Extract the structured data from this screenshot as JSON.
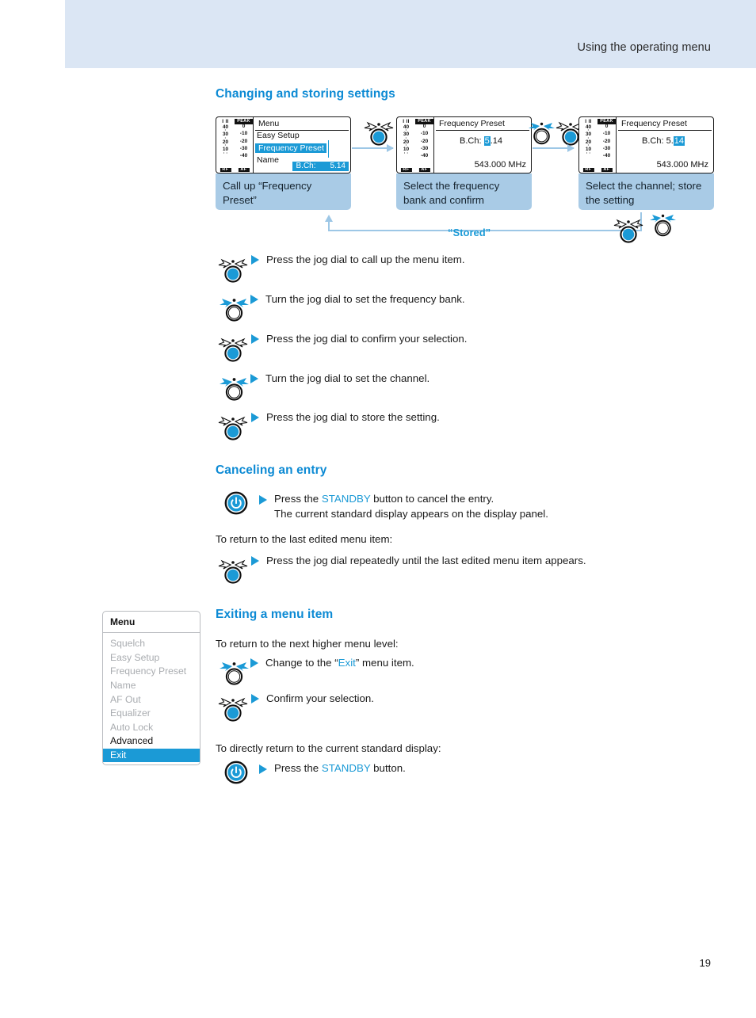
{
  "header": {
    "title": "Using the operating menu"
  },
  "page": {
    "number": "19"
  },
  "colors": {
    "accent_blue": "#1b9ad6",
    "header_band": "#dbe6f4",
    "caption_box": "#a9cbe6",
    "flow_arrow": "#9dc7e6"
  },
  "sections": {
    "changing": {
      "heading": "Changing and storing settings",
      "flow": {
        "panels": [
          {
            "display": {
              "title": "Menu",
              "lines": [
                "Easy Setup",
                "Frequency Preset",
                "Name"
              ],
              "selected_line": "Frequency Preset",
              "bch_label": "B.Ch:",
              "bch_value": "5.14"
            },
            "caption": "Call up “Frequency Preset”"
          },
          {
            "display": {
              "title": "Frequency Preset",
              "bch_label": "B.Ch:",
              "bch_bank": "5",
              "bch_sep": ".",
              "bch_channel": "14",
              "highlight": "bank",
              "frequency": "543.000 MHz"
            },
            "caption": "Select the frequency bank and confirm"
          },
          {
            "display": {
              "title": "Frequency Preset",
              "bch_label": "B.Ch:",
              "bch_bank": "5",
              "bch_sep": ".",
              "bch_channel": "14",
              "highlight": "channel",
              "frequency": "543.000 MHz"
            },
            "caption": "Select the channel; store the setting"
          }
        ],
        "feedback_label": "“Stored”",
        "meter": {
          "left_header": "I II",
          "right_header": "PEAK",
          "left_values": [
            "40",
            "30",
            "20",
            "10"
          ],
          "right_values": [
            "0",
            "-10",
            "-20",
            "-30",
            "-40"
          ],
          "left_tag": "RF",
          "right_tag": "AF"
        }
      },
      "steps": [
        {
          "icon": "jog-dial-press-icon",
          "text": "Press the jog dial to call up the menu item."
        },
        {
          "icon": "jog-dial-turn-icon",
          "text": "Turn the jog dial to set the frequency bank."
        },
        {
          "icon": "jog-dial-press-icon",
          "text": "Press the jog dial to confirm your selection."
        },
        {
          "icon": "jog-dial-turn-icon",
          "text": "Turn the jog dial to set the channel."
        },
        {
          "icon": "jog-dial-press-icon",
          "text": "Press the jog dial to store the setting."
        }
      ]
    },
    "canceling": {
      "heading": "Canceling an entry",
      "step1": {
        "icon": "standby-button-icon",
        "line1_pre": "Press the ",
        "line1_key": "STANDBY",
        "line1_post": " button to cancel the entry.",
        "line2": "The current standard display appears on the display panel."
      },
      "intro2": "To return to the last edited menu item:",
      "step2": {
        "icon": "jog-dial-press-icon",
        "text": "Press the jog dial repeatedly until the last edited menu item appears."
      }
    },
    "exiting": {
      "heading": "Exiting a menu item",
      "menu_panel": {
        "title": "Menu",
        "items": [
          {
            "label": "Squelch",
            "state": "dimmed"
          },
          {
            "label": "Easy Setup",
            "state": "dimmed"
          },
          {
            "label": "Frequency Preset",
            "state": "dimmed"
          },
          {
            "label": "Name",
            "state": "dimmed"
          },
          {
            "label": "AF Out",
            "state": "dimmed"
          },
          {
            "label": "Equalizer",
            "state": "dimmed"
          },
          {
            "label": "Auto Lock",
            "state": "dimmed"
          },
          {
            "label": "Advanced",
            "state": "active"
          },
          {
            "label": "Exit",
            "state": "selected"
          }
        ]
      },
      "intro1": "To return to the next higher menu level:",
      "step1": {
        "icon": "jog-dial-turn-icon",
        "pre": "Change to the “",
        "key": "Exit",
        "post": "” menu item."
      },
      "step2": {
        "icon": "jog-dial-press-icon",
        "text": "Confirm your selection."
      },
      "intro2": "To directly return to the current standard display:",
      "step3": {
        "icon": "standby-button-icon",
        "pre": "Press the ",
        "key": "STANDBY",
        "post": " button."
      }
    }
  }
}
